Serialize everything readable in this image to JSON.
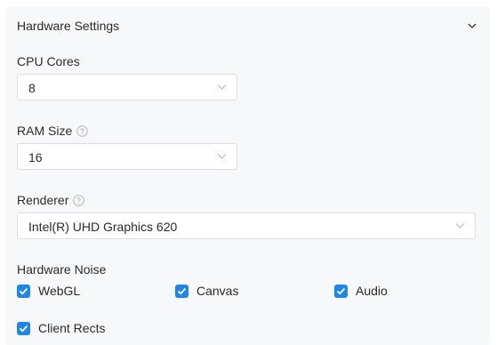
{
  "section": {
    "title": "Hardware Settings"
  },
  "cpu_cores": {
    "label": "CPU Cores",
    "value": "8"
  },
  "ram_size": {
    "label": "RAM Size",
    "value": "16"
  },
  "renderer": {
    "label": "Renderer",
    "value": "Intel(R) UHD Graphics 620"
  },
  "hardware_noise": {
    "label": "Hardware Noise",
    "options": [
      {
        "label": "WebGL",
        "checked": true
      },
      {
        "label": "Canvas",
        "checked": true
      },
      {
        "label": "Audio",
        "checked": true
      },
      {
        "label": "Client Rects",
        "checked": true
      }
    ]
  },
  "colors": {
    "panel_bg": "#f7f8fa",
    "checkbox_accent": "#1f86e6",
    "border": "#dcdfe6"
  },
  "icons": {
    "collapse": "chevron-down-icon",
    "help": "question-circle-icon",
    "dropdown": "chevron-down-icon",
    "check": "checkmark-icon"
  }
}
